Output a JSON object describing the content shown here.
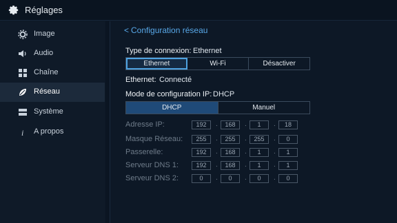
{
  "app": {
    "title": "Réglages",
    "icon": "gear-icon"
  },
  "sidebar": {
    "items": [
      {
        "label": "Image",
        "icon": "image-settings-icon",
        "active": false
      },
      {
        "label": "Audio",
        "icon": "speaker-icon",
        "active": false
      },
      {
        "label": "Chaîne",
        "icon": "grid-icon",
        "active": false
      },
      {
        "label": "Réseau",
        "icon": "network-leaf-icon",
        "active": true
      },
      {
        "label": "Système",
        "icon": "system-icon",
        "active": false
      },
      {
        "label": "A propos",
        "icon": "info-icon",
        "active": false
      }
    ]
  },
  "main": {
    "back_label": "Configuration réseau",
    "connection_type": {
      "label": "Type de connexion:",
      "value": "Ethernet",
      "options": [
        "Ethernet",
        "Wi-Fi",
        "Désactiver"
      ],
      "selected": "Ethernet"
    },
    "ethernet_status": {
      "label": "Ethernet:",
      "value": "Connecté"
    },
    "ip_mode": {
      "label": "Mode de configuration IP:",
      "value": "DHCP",
      "options": [
        "DHCP",
        "Manuel"
      ],
      "selected": "DHCP"
    },
    "fields": [
      {
        "label": "Adresse IP:",
        "octets": [
          "192",
          "168",
          "1",
          "18"
        ]
      },
      {
        "label": "Masque Réseau:",
        "octets": [
          "255",
          "255",
          "255",
          "0"
        ]
      },
      {
        "label": "Passerelle:",
        "octets": [
          "192",
          "168",
          "1",
          "1"
        ]
      },
      {
        "label": "Serveur DNS 1:",
        "octets": [
          "192",
          "168",
          "1",
          "1"
        ]
      },
      {
        "label": "Serveur DNS 2:",
        "octets": [
          "0",
          "0",
          "0",
          "0"
        ]
      }
    ],
    "separator": "."
  },
  "colors": {
    "accent": "#58a8e8",
    "selected_fill": "#1f4a78",
    "background": "#0d1826"
  }
}
